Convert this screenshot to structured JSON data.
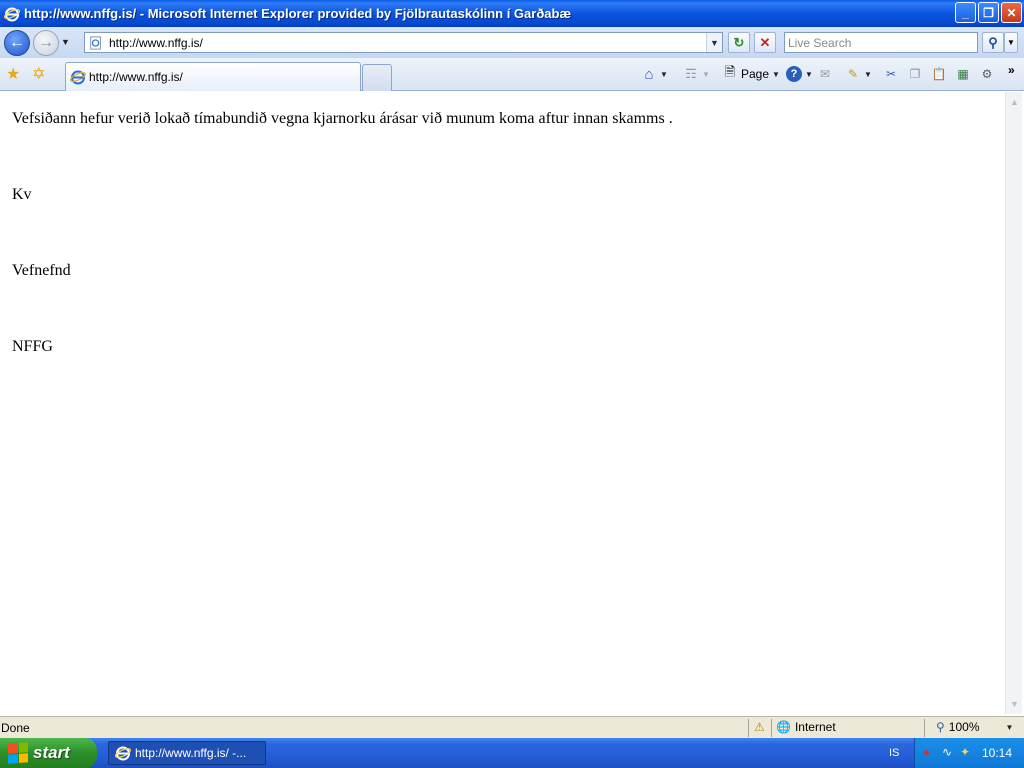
{
  "window": {
    "title": "http://www.nffg.is/ - Microsoft Internet Explorer provided by Fjölbrautaskólinn í Garðabæ",
    "minimize": "_",
    "restore": "❐",
    "close": "✕"
  },
  "addressbar": {
    "url": "http://www.nffg.is/",
    "search_placeholder": "Live Search"
  },
  "tabs": [
    {
      "label": "http://www.nffg.is/"
    }
  ],
  "commandbar": {
    "page_label": "Page"
  },
  "content": {
    "line1": "Vefsiðann hefur verið lokað tímabundið vegna kjarnorku árásar við munum koma aftur innan skamms .",
    "line2": "Kv",
    "line3": "Vefnefnd",
    "line4": "NFFG"
  },
  "statusbar": {
    "status": "Done",
    "zone": "Internet",
    "zoom": "100%"
  },
  "taskbar": {
    "start_label": "start",
    "window_item": "http://www.nffg.is/ -...",
    "language": "IS",
    "clock": "10:14"
  },
  "icons": {
    "ie": "ie-icon",
    "back": "back-arrow-icon",
    "forward": "forward-arrow-icon",
    "refresh": "refresh-icon",
    "stop": "stop-icon",
    "search": "magnifier-icon",
    "favorites": "star-icon",
    "add_favorites": "add-favorites-icon",
    "home": "home-icon",
    "feeds": "rss-feed-icon",
    "help": "help-icon",
    "globe": "globe-icon"
  }
}
